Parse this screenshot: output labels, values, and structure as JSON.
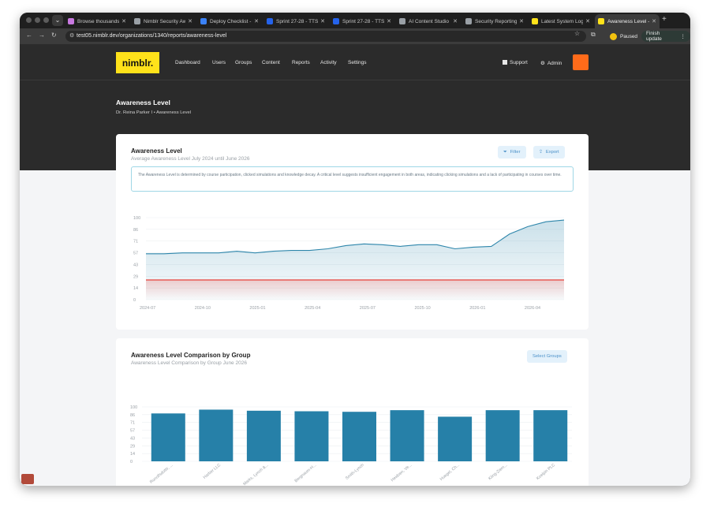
{
  "browser": {
    "tabs": [
      {
        "label": "Browse thousands o",
        "color": "#c879e0"
      },
      {
        "label": "Nimblr Security Aw",
        "color": "#9aa0a6"
      },
      {
        "label": "Deploy Checklist - ",
        "color": "#3b82f6"
      },
      {
        "label": "Sprint 27-28 - TTS",
        "color": "#2563eb"
      },
      {
        "label": "Sprint 27-28 - TTS",
        "color": "#2563eb"
      },
      {
        "label": "AI Content Studio |",
        "color": "#9aa0a6"
      },
      {
        "label": "Security Reporting",
        "color": "#9aa0a6"
      },
      {
        "label": "Latest System Logs",
        "color": "#ffe21a"
      },
      {
        "label": "Awareness Level - ",
        "color": "#ffe21a",
        "active": true
      }
    ],
    "url": "test05.nimblr.dev/organizations/1340/reports/awareness-level",
    "paused_label": "Paused",
    "finish_update_label": "Finish update"
  },
  "app": {
    "logo": "nimblr.",
    "nav": [
      "Dashboard",
      "Users",
      "Groups",
      "Content",
      "Reports",
      "Activity",
      "Settings"
    ],
    "support_label": "Support",
    "admin_label": "Admin",
    "accent": "#ff6b1a",
    "brand": "#ffe21a"
  },
  "page": {
    "title": "Awareness Level",
    "breadcrumb": [
      "Dr. Reina Parker I",
      "Awareness Level"
    ]
  },
  "card1": {
    "title": "Awareness Level",
    "subtitle": "Average Awareness Level July 2024 until June 2026",
    "filter_label": "Filter",
    "export_label": "Export",
    "info": "The Awareness Level is determined by course participation, clicked simulations and knowledge decay. A critical level suggests insufficient engagement in both areas, indicating clicking simulations and a lack of participating in courses over time."
  },
  "card2": {
    "title": "Awareness Level Comparison by Group",
    "subtitle": "Awareness Level Comparison by Group June 2026",
    "select_label": "Select Groups"
  },
  "chart_data": [
    {
      "type": "area",
      "y_ticks": [
        "100",
        "86",
        "71",
        "57",
        "43",
        "29",
        "14",
        "0"
      ],
      "x_ticks": [
        "2024-07",
        "2024-10",
        "2025-01",
        "2025-04",
        "2025-07",
        "2025-10",
        "2026-01",
        "2026-04"
      ],
      "ylim": [
        0,
        100
      ],
      "series": [
        {
          "values": [
            56,
            56,
            57,
            57,
            57,
            59,
            57,
            59,
            60,
            60,
            62,
            66,
            68,
            67,
            65,
            67,
            67,
            62,
            64,
            65,
            80,
            89,
            95,
            97
          ],
          "color": "#2e86ab"
        },
        {
          "values": [
            24,
            24,
            24,
            24,
            24,
            24,
            24,
            24,
            24,
            24,
            24,
            24,
            24,
            24,
            24,
            24,
            24,
            24,
            24,
            24,
            24,
            24,
            24,
            24
          ],
          "color": "#e8413a"
        }
      ]
    },
    {
      "type": "bar",
      "y_ticks": [
        "100",
        "86",
        "71",
        "57",
        "43",
        "29",
        "14",
        "0"
      ],
      "ylim": [
        0,
        100
      ],
      "categories": [
        "Runolfsdottir, ...",
        "Harber LLC",
        "Marks, Lynch &...",
        "Bergnaum-H...",
        "Smith-Lynch",
        "Heidsen, Ve...",
        "Huegel, Ch...",
        "Kling-Ziem...",
        "Koelpin PLC"
      ],
      "values": [
        88,
        95,
        93,
        92,
        91,
        94,
        82,
        94,
        94
      ],
      "color": "#2680a8"
    }
  ]
}
